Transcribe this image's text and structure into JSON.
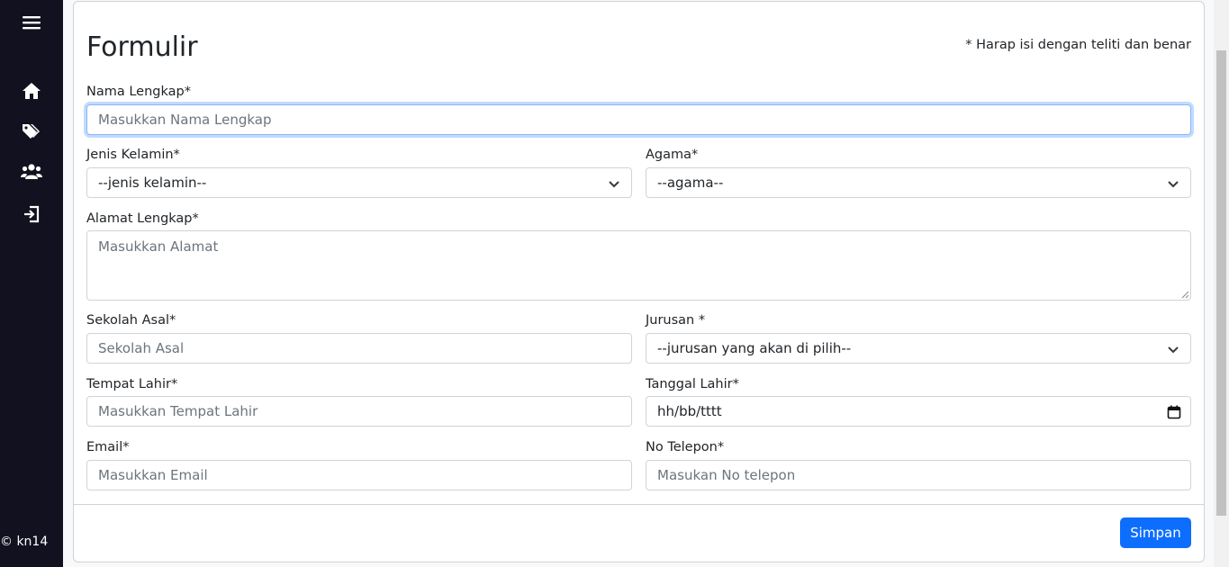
{
  "sidebar": {
    "items": [
      {
        "icon": "menu-icon"
      },
      {
        "icon": "home-icon"
      },
      {
        "icon": "tags-icon"
      },
      {
        "icon": "users-icon"
      },
      {
        "icon": "logout-icon"
      }
    ],
    "copyright": "© kn14"
  },
  "form": {
    "title": "Formulir",
    "note": "* Harap isi dengan teliti dan benar",
    "nama": {
      "label": "Nama Lengkap*",
      "placeholder": "Masukkan Nama Lengkap"
    },
    "jenis_kelamin": {
      "label": "Jenis Kelamin*",
      "selected": "--jenis kelamin--"
    },
    "agama": {
      "label": "Agama*",
      "selected": "--agama--"
    },
    "alamat": {
      "label": "Alamat Lengkap*",
      "placeholder": "Masukkan Alamat"
    },
    "sekolah": {
      "label": "Sekolah Asal*",
      "placeholder": "Sekolah Asal"
    },
    "jurusan": {
      "label": "Jurusan *",
      "selected": "--jurusan yang akan di pilih--"
    },
    "tempat_lahir": {
      "label": "Tempat Lahir*",
      "placeholder": "Masukkan Tempat Lahir"
    },
    "tanggal_lahir": {
      "label": "Tanggal Lahir*",
      "value": "hh/bb/tttt"
    },
    "email": {
      "label": "Email*",
      "placeholder": "Masukkan Email"
    },
    "telepon": {
      "label": "No Telepon*",
      "placeholder": "Masukan No telepon"
    },
    "submit_label": "Simpan"
  },
  "colors": {
    "sidebar_bg": "#11111f",
    "primary": "#0d6efd",
    "focus_border": "#86b7fe"
  }
}
